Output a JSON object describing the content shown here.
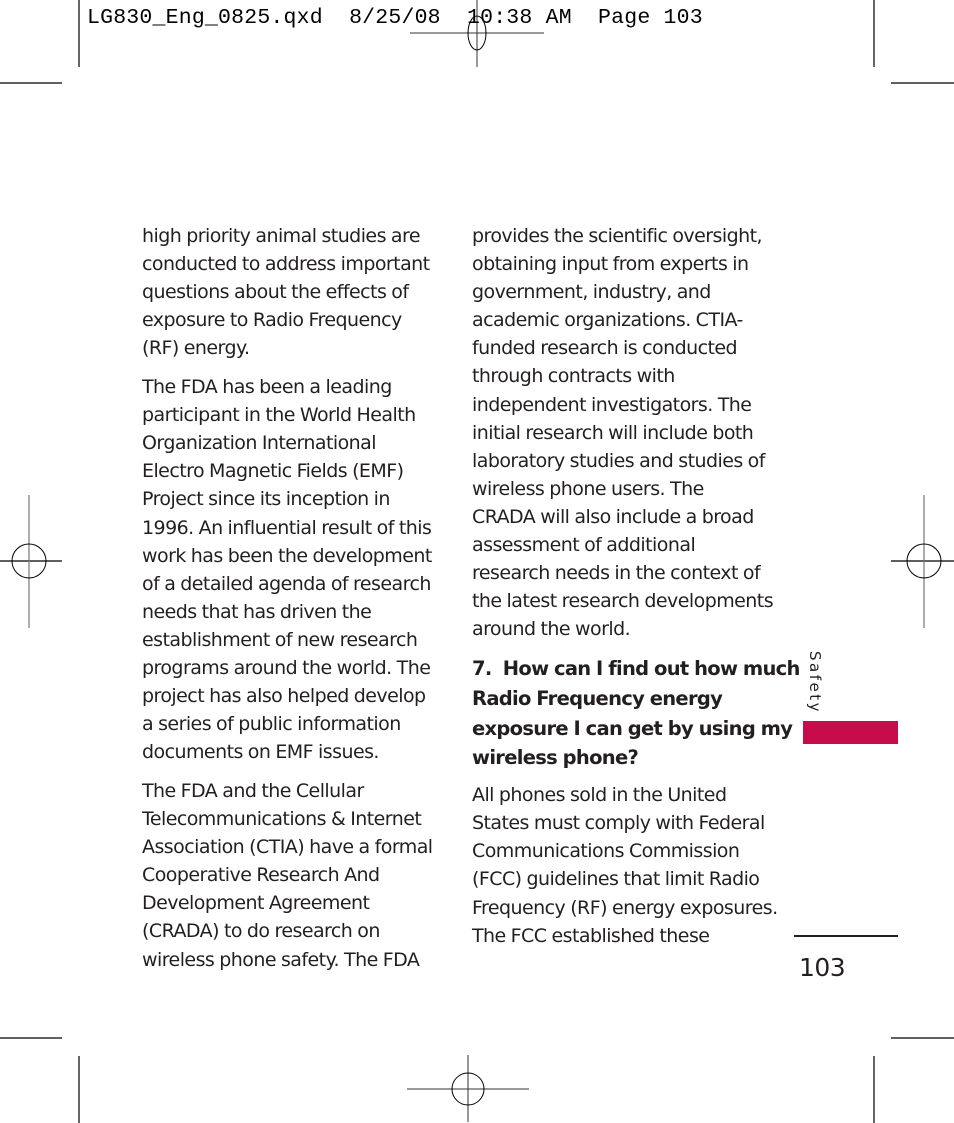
{
  "slug": {
    "filename": "LG830_Eng_0825.qxd",
    "date": "8/25/08",
    "time": "10:38 AM",
    "page_label": "Page 103"
  },
  "left_column": {
    "paragraphs": [
      {
        "lines": [
          "high priority animal studies are",
          "conducted to address important",
          "questions about the effects of",
          "exposure to Radio Frequency",
          "(RF) energy."
        ]
      },
      {
        "lines": [
          "The FDA has been a leading",
          "participant in the World Health",
          "Organization International",
          "Electro Magnetic Fields (EMF)",
          "Project since its inception in",
          "1996. An influential result of this",
          "work has been the development",
          "of a detailed agenda of research",
          "needs that has driven the",
          "establishment of new research",
          "programs around the world. The",
          "project has also helped develop",
          "a series of public information",
          "documents on EMF issues."
        ]
      },
      {
        "lines": [
          "The FDA and the Cellular",
          "Telecommunications & Internet",
          "Association (CTIA) have a formal",
          "Cooperative Research And",
          "Development Agreement",
          "(CRADA) to do research on",
          "wireless phone safety. The FDA"
        ]
      }
    ]
  },
  "right_column": {
    "paragraph_1": {
      "lines": [
        "provides the scientific oversight,",
        "obtaining input from experts in",
        "government, industry, and",
        "academic organizations. CTIA-",
        "funded research is conducted",
        "through contracts with",
        "independent investigators. The",
        "initial research will include both",
        "laboratory studies and studies of",
        "wireless phone users. The",
        "CRADA will also include a broad",
        "assessment of additional",
        "research needs in the context of",
        "the latest research developments",
        "around the world."
      ]
    },
    "question_heading": {
      "lines": [
        "7.  How can I find out how much",
        "Radio Frequency energy",
        "exposure I can get by using my",
        "wireless phone?"
      ]
    },
    "paragraph_2": {
      "lines": [
        "All phones sold in the United",
        "States must comply with Federal",
        "Communications Commission",
        "(FCC) guidelines that limit Radio",
        "Frequency (RF) energy exposures.",
        "The FCC established these"
      ]
    }
  },
  "side_tab": {
    "label": "Safety",
    "color": "#c60c4b"
  },
  "folio": {
    "page_number": "103"
  }
}
